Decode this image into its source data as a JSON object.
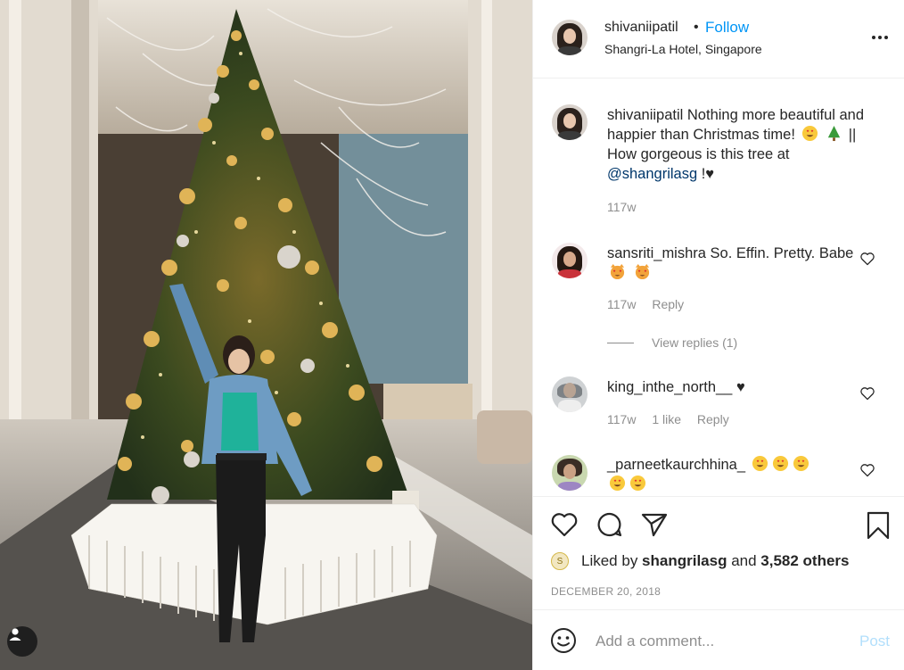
{
  "post": {
    "username": "shivaniipatil",
    "dot": "•",
    "follow_label": "Follow",
    "location": "Shangri-La Hotel, Singapore",
    "more_icon": "more-horizontal-icon"
  },
  "caption": {
    "username": "shivaniipatil",
    "text_1": "Nothing more beautiful and happier than Christmas time! ",
    "text_2": "|| How gorgeous is this tree at",
    "mention": "@shangrilasg",
    "text_3": " !♥",
    "time": "117w"
  },
  "comments": [
    {
      "username": "sansriti_mishra",
      "text": "So. Effin. Pretty. Babe",
      "emojis": [
        "heart-eyes-cat",
        "heart-eyes-cat"
      ],
      "time": "117w",
      "reply_label": "Reply",
      "view_replies": "View replies (1)"
    },
    {
      "username": "king_inthe_north__",
      "text": "♥",
      "time": "117w",
      "likes": "1 like",
      "reply_label": "Reply"
    },
    {
      "username": "_parneetkaurchhina_",
      "emojis": [
        "heart-eyes",
        "heart-eyes",
        "heart-eyes",
        "heart-eyes",
        "heart-eyes"
      ]
    }
  ],
  "likes": {
    "prefix": "Liked by ",
    "user": "shangrilasg",
    "middle": " and ",
    "count": "3,582 others"
  },
  "date": "DECEMBER 20, 2018",
  "add_comment": {
    "placeholder": "Add a comment...",
    "post_label": "Post"
  },
  "colors": {
    "follow": "#0095f6",
    "post_disabled": "#b2dffc",
    "meta": "#8e8e8e",
    "text": "#262626"
  }
}
